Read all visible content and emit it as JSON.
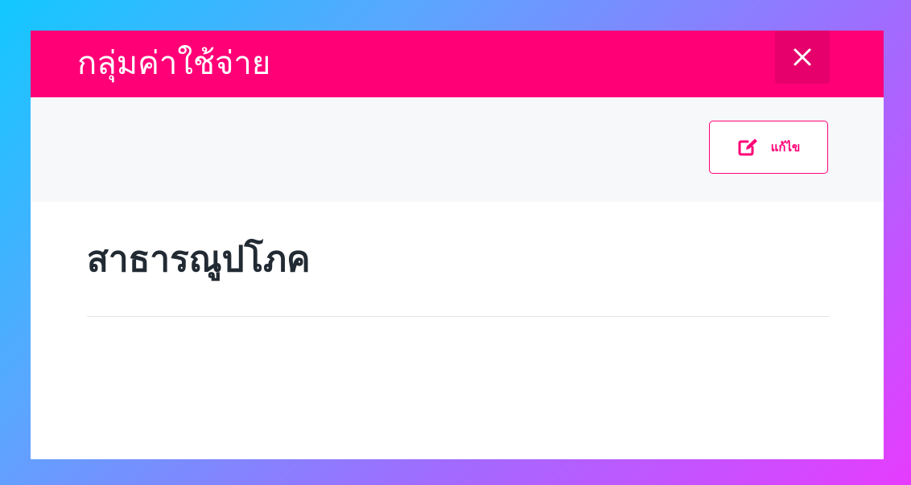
{
  "modal": {
    "title": "กลุ่มค่าใช้จ่าย",
    "close_icon": "close-icon",
    "header_color": "#ff0077"
  },
  "toolbar": {
    "edit_label": "แก้ไข",
    "edit_icon": "edit-icon"
  },
  "content": {
    "group_name": "สาธารณูปโภค"
  }
}
